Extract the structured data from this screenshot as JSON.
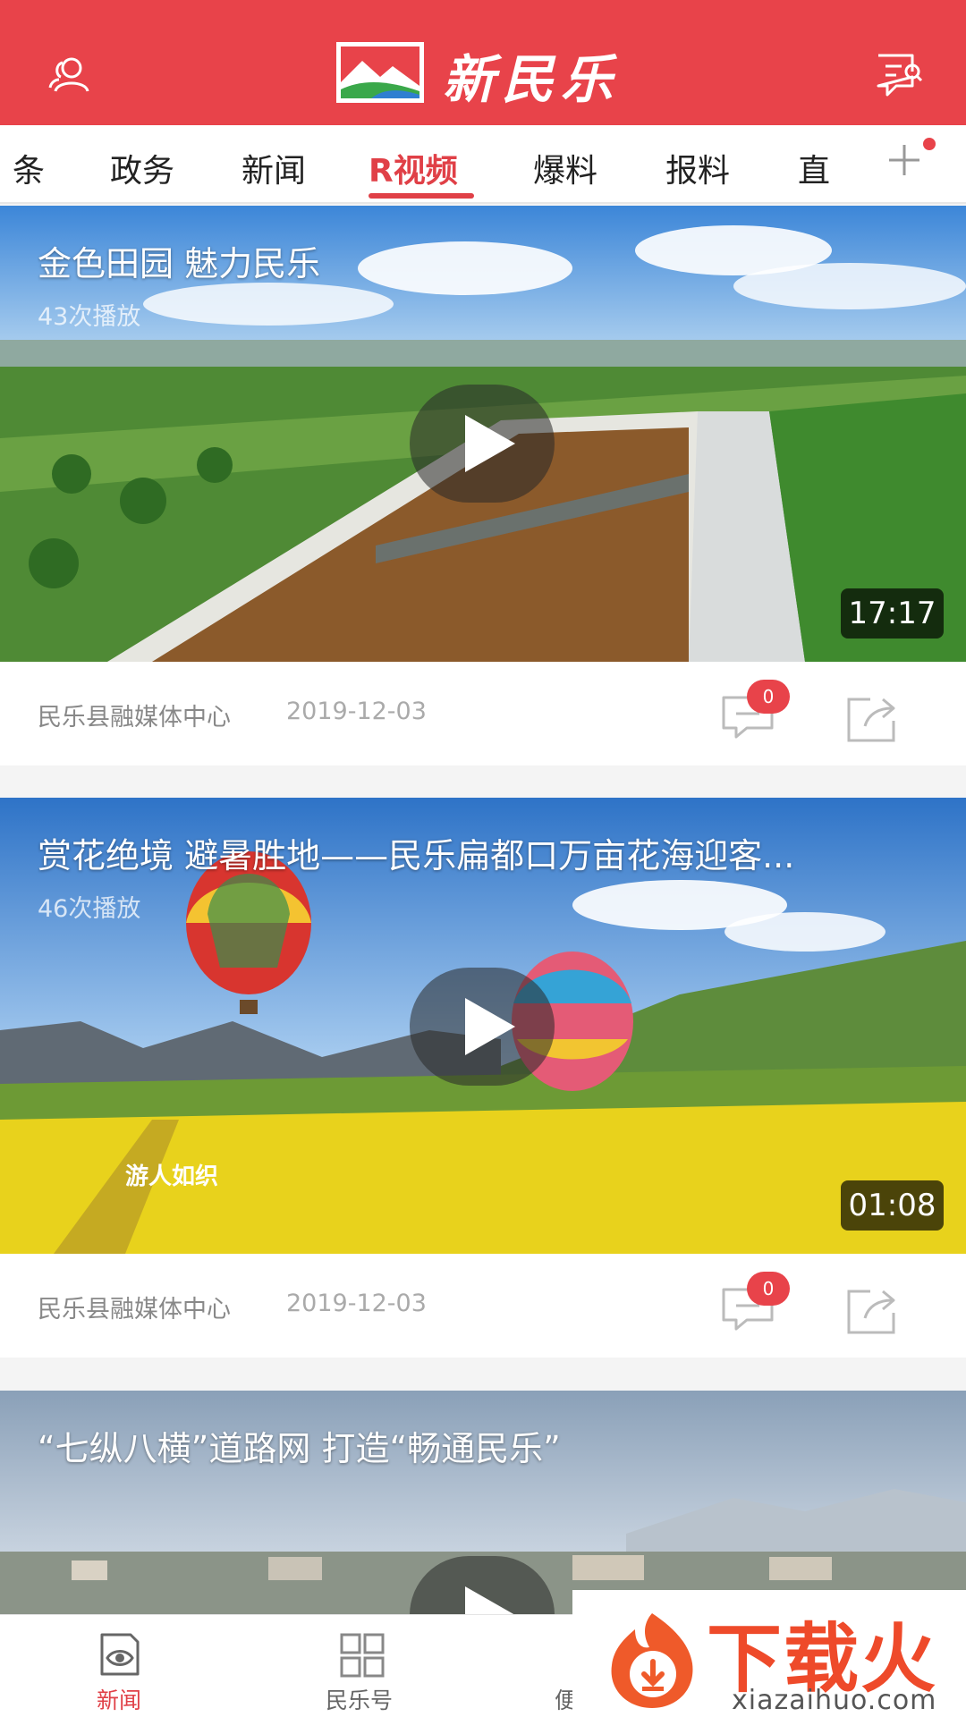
{
  "app": {
    "name": "新民乐",
    "colors": {
      "brand": "#e8434a",
      "active": "#e04047",
      "text": "#222222",
      "muted": "#888888"
    }
  },
  "header": {
    "title": "新民乐",
    "left_icon": "user-icon",
    "right_icon": "message-search-icon"
  },
  "tabs": {
    "items": [
      {
        "label": "条"
      },
      {
        "label": "政务"
      },
      {
        "label": "新闻"
      },
      {
        "label": "R视频"
      },
      {
        "label": "爆料"
      },
      {
        "label": "报料"
      },
      {
        "label": "直"
      }
    ],
    "active_index": 3,
    "add_icon": "plus-icon"
  },
  "videos": [
    {
      "title": "金色田园 魅力民乐",
      "plays": "43次播放",
      "duration": "17:17",
      "source": "民乐县融媒体中心",
      "date": "2019-12-03",
      "comments": "0"
    },
    {
      "title": "赏花绝境 避暑胜地——民乐扁都口万亩花海迎客...",
      "plays": "46次播放",
      "duration": "01:08",
      "source": "民乐县融媒体中心",
      "date": "2019-12-03",
      "comments": "0",
      "overlay_text": "游人如织"
    },
    {
      "title": "“七纵八横”道路网  打造“畅通民乐”"
    }
  ],
  "bottom_nav": {
    "items": [
      {
        "label": "新闻",
        "icon": "eye-screen-icon"
      },
      {
        "label": "民乐号",
        "icon": "grid-icon"
      },
      {
        "label": "便",
        "icon": "service-icon"
      }
    ],
    "active_index": 0
  },
  "watermark": {
    "text": "下载火",
    "url": "xiazaihuo.com"
  }
}
